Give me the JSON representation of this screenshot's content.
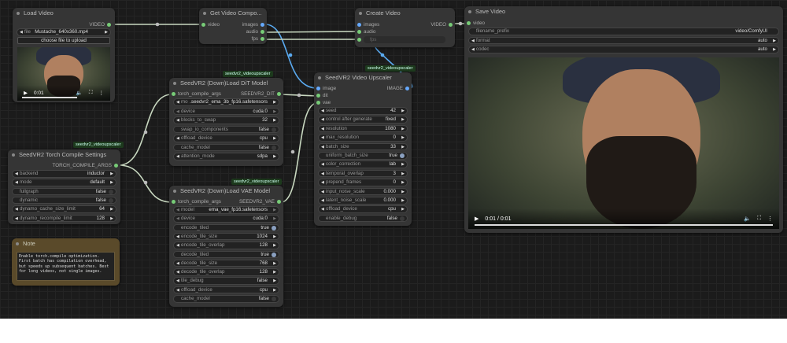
{
  "badge": "seedvr2_videoupscaler",
  "load_video": {
    "title": "Load Video",
    "output": "VIDEO",
    "file_label": "file",
    "file_value": "Mustache_640x360.mp4",
    "upload": "choose file to upload",
    "time": "0:01"
  },
  "get_components": {
    "title": "Get Video Compo...",
    "input": "video",
    "outputs": [
      "images",
      "audio",
      "fps"
    ]
  },
  "create_video": {
    "title": "Create Video",
    "inputs": [
      "images",
      "audio",
      "fps"
    ],
    "output": "VIDEO"
  },
  "save_video": {
    "title": "Save Video",
    "input": "video",
    "widgets": [
      {
        "label": "filename_prefix",
        "value": "video/ComfyUI",
        "type": "text"
      },
      {
        "label": "format",
        "value": "auto",
        "type": "combo"
      },
      {
        "label": "codec",
        "value": "auto",
        "type": "combo"
      }
    ],
    "time": "0:01 / 0:01"
  },
  "dit": {
    "title": "SeedVR2 (Down)Load DiT Model",
    "input": "torch_compile_args",
    "output": "SEEDVR2_DIT",
    "widgets": [
      {
        "label": "mo ...",
        "value": "seedvr2_ema_3b_fp16.safetensors",
        "type": "combo"
      },
      {
        "label": "device",
        "value": "cuda:0",
        "type": "dis"
      },
      {
        "label": "blocks_to_swap",
        "value": "32",
        "type": "combo"
      },
      {
        "label": "swap_io_components",
        "value": "false",
        "type": "toggle-off"
      },
      {
        "label": "offload_device",
        "value": "cpu",
        "type": "combo"
      },
      {
        "label": "cache_model",
        "value": "false",
        "type": "toggle-off"
      },
      {
        "label": "attention_mode",
        "value": "sdpa",
        "type": "combo"
      }
    ]
  },
  "upscaler": {
    "title": "SeedVR2 Video Upscaler",
    "inputs": [
      "image",
      "dit",
      "vae"
    ],
    "output": "IMAGE",
    "widgets": [
      {
        "label": "seed",
        "value": "42",
        "type": "combo"
      },
      {
        "label": "control after generate",
        "value": "fixed",
        "type": "combo"
      },
      {
        "label": "resolution",
        "value": "1080",
        "type": "combo"
      },
      {
        "label": "max_resolution",
        "value": "0",
        "type": "combo"
      },
      {
        "label": "batch_size",
        "value": "33",
        "type": "combo"
      },
      {
        "label": "uniform_batch_size",
        "value": "true",
        "type": "toggle-on"
      },
      {
        "label": "color_correction",
        "value": "lab",
        "type": "combo"
      },
      {
        "label": "temporal_overlap",
        "value": "3",
        "type": "combo"
      },
      {
        "label": "prepend_frames",
        "value": "0",
        "type": "combo"
      },
      {
        "label": "input_noise_scale",
        "value": "0.000",
        "type": "combo"
      },
      {
        "label": "latent_noise_scale",
        "value": "0.000",
        "type": "combo"
      },
      {
        "label": "offload_device",
        "value": "cpu",
        "type": "combo"
      },
      {
        "label": "enable_debug",
        "value": "false",
        "type": "toggle-off"
      }
    ]
  },
  "torch": {
    "title": "SeedVR2 Torch Compile Settings",
    "output": "TORCH_COMPILE_ARGS",
    "widgets": [
      {
        "label": "backend",
        "value": "inductor",
        "type": "combo"
      },
      {
        "label": "mode",
        "value": "default",
        "type": "combo"
      },
      {
        "label": "fullgraph",
        "value": "false",
        "type": "toggle-off"
      },
      {
        "label": "dynamic",
        "value": "false",
        "type": "toggle-off"
      },
      {
        "label": "dynamo_cache_size_limit",
        "value": "64",
        "type": "combo"
      },
      {
        "label": "dynamo_recompile_limit",
        "value": "128",
        "type": "combo"
      }
    ]
  },
  "note": {
    "title": "Note",
    "text": "Enable torch.compile optimization. First batch has compilation overhead, but speeds up subsequent batches. Best for long videos, not single images."
  },
  "vae": {
    "title": "SeedVR2 (Down)Load VAE Model",
    "input": "torch_compile_args",
    "output": "SEEDVR2_VAE",
    "widgets": [
      {
        "label": "model",
        "value": "ema_vae_fp16.safetensors",
        "type": "dis"
      },
      {
        "label": "device",
        "value": "cuda:0",
        "type": "dis"
      },
      {
        "label": "encode_tiled",
        "value": "true",
        "type": "toggle-on"
      },
      {
        "label": "encode_tile_size",
        "value": "1024",
        "type": "combo"
      },
      {
        "label": "encode_tile_overlap",
        "value": "128",
        "type": "combo"
      },
      {
        "label": "decode_tiled",
        "value": "true",
        "type": "toggle-on"
      },
      {
        "label": "decode_tile_size",
        "value": "768",
        "type": "combo"
      },
      {
        "label": "decode_tile_overlap",
        "value": "128",
        "type": "combo"
      },
      {
        "label": "tile_debug",
        "value": "false",
        "type": "combo"
      },
      {
        "label": "offload_device",
        "value": "cpu",
        "type": "combo"
      },
      {
        "label": "cache_model",
        "value": "false",
        "type": "toggle-off"
      }
    ]
  },
  "colors": {
    "link_green": "#c8d8c0",
    "link_blue": "#5aaaf0",
    "canvas": "#1b1b1b"
  }
}
